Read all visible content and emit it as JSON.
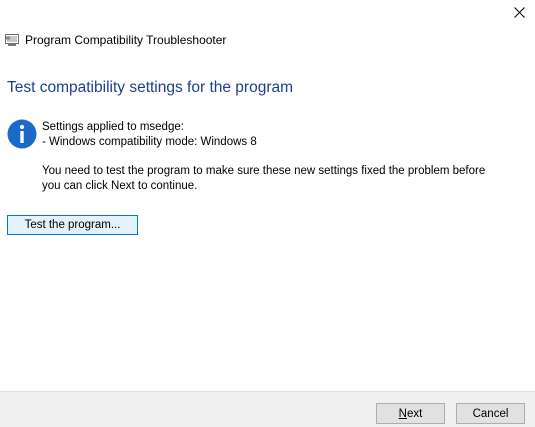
{
  "window": {
    "title": "Program Compatibility Troubleshooter"
  },
  "main": {
    "heading": "Test compatibility settings for the program",
    "settings_line": "Settings applied to msedge:",
    "mode_line": "- Windows compatibility mode: Windows 8",
    "instruction_line1": "You need to test the program to make sure these new settings fixed the problem before",
    "instruction_line2": "you can click Next to continue.",
    "test_button": "Test the program..."
  },
  "footer": {
    "next_accel": "N",
    "next_rest": "ext",
    "cancel": "Cancel"
  },
  "icons": {
    "close": "close-icon",
    "app": "troubleshooter-app-icon",
    "info": "info-icon"
  },
  "colors": {
    "heading": "#1e3e8f",
    "info_icon": "#1b6ac9",
    "button_focus_border": "#0078d7",
    "footer_background": "#f0f0f0"
  }
}
